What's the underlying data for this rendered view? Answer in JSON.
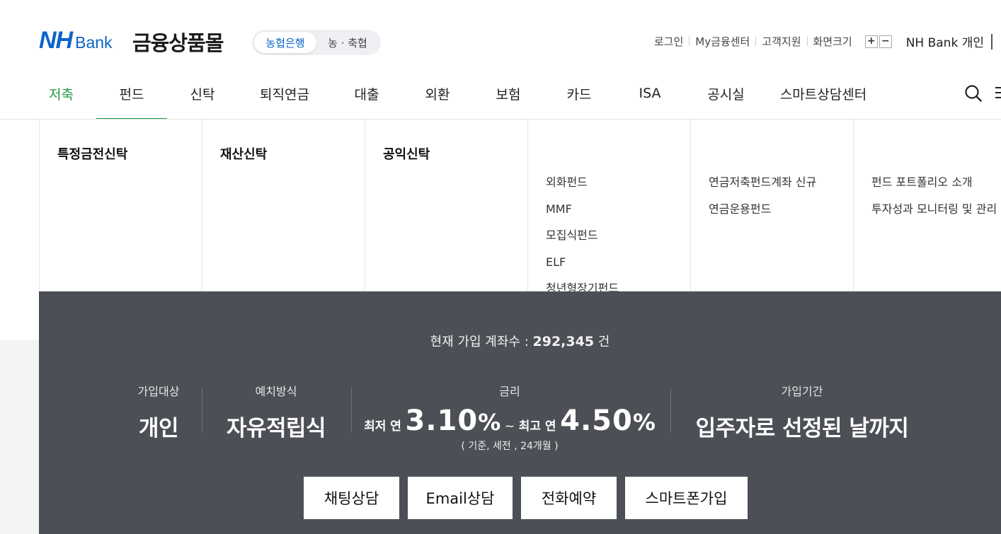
{
  "header": {
    "logo_nh": "NH",
    "logo_bank": "Bank",
    "mall_title": "금융상품몰",
    "bank_toggle": [
      "농협은행",
      "농 · 축협"
    ],
    "util_links": [
      "로그인",
      "My금융센터",
      "고객지원",
      "화면크기"
    ],
    "zoom_plus": "+",
    "zoom_minus": "−",
    "service_select": "NH Bank 개인"
  },
  "nav": {
    "items": [
      "저축",
      "펀드",
      "신탁",
      "퇴직연금",
      "대출",
      "외환",
      "보험",
      "카드",
      "ISA",
      "공시실",
      "스마트상담센터"
    ],
    "active_item": "펀드",
    "accent_color": "#1e9a3f"
  },
  "mega_menu": {
    "columns": [
      {
        "title": "특정금전신탁",
        "links": []
      },
      {
        "title": "재산신탁",
        "links": []
      },
      {
        "title": "공익신탁",
        "links": []
      },
      {
        "title": "",
        "links": [
          "외화펀드",
          "MMF",
          "모집식펀드",
          "ELF",
          "청년형장기펀드"
        ]
      },
      {
        "title": "",
        "links": [
          "연금저축펀드계좌 신규",
          "연금운용펀드"
        ]
      },
      {
        "title": "",
        "links": [
          "펀드 포트폴리오 소개",
          "투자성과 모니터링 및 관리"
        ]
      }
    ]
  },
  "product": {
    "account_count_label": "현재 가입 계좌수 :",
    "account_count": "292,345",
    "account_count_unit": "건",
    "target_label": "가입대상",
    "target_value": "개인",
    "method_label": "예치방식",
    "method_value": "자유적립식",
    "rate_label": "금리",
    "rate_min_prefix": "최저 연",
    "rate_min": "3.10",
    "rate_pct": "%",
    "rate_sep": "~",
    "rate_max_prefix": "최고 연",
    "rate_max": "4.50",
    "rate_note": "( 기준, 세전 , 24개월 )",
    "period_label": "가입기간",
    "period_value": "입주자로 선정된 날까지",
    "panel_color": "#4d4f56"
  },
  "actions": [
    "채팅상담",
    "Email상담",
    "전화예약",
    "스마트폰가입"
  ]
}
